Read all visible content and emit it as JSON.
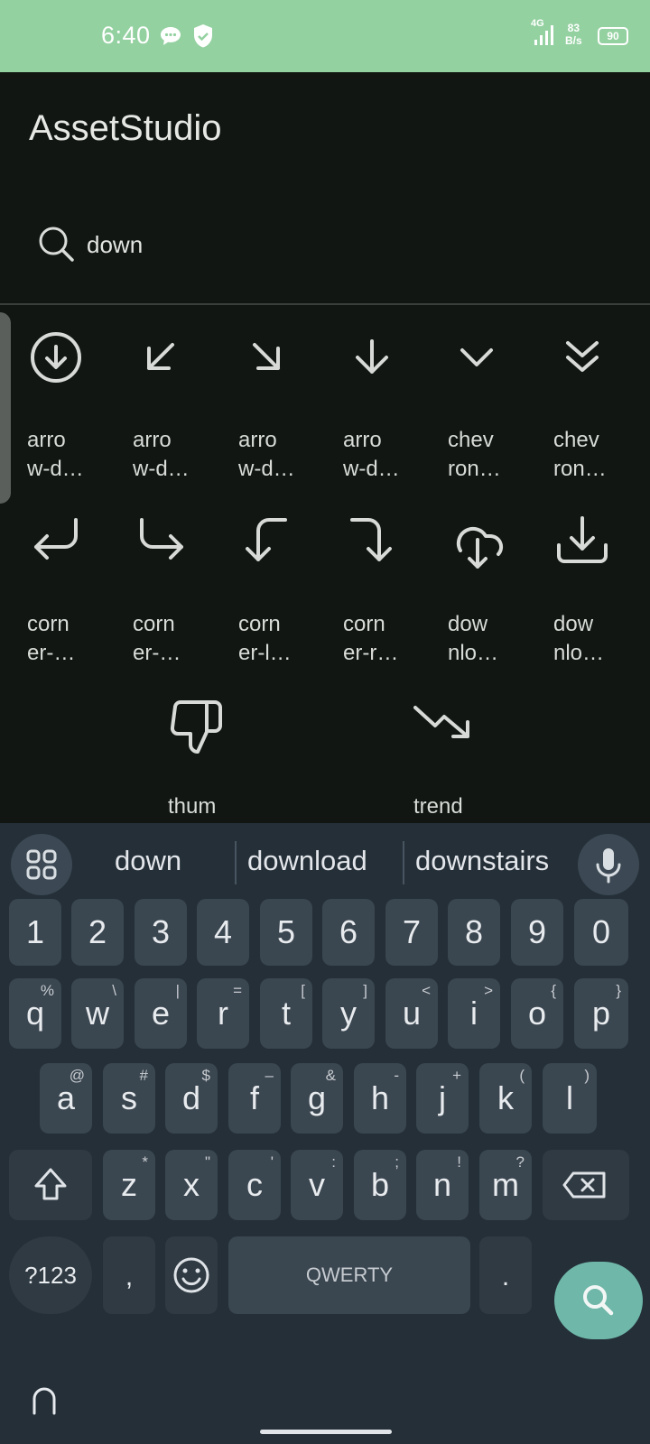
{
  "status_bar": {
    "time": "6:40",
    "network": "4G",
    "speed_value": "83",
    "speed_unit": "B/s",
    "battery": "90"
  },
  "app": {
    "title": "AssetStudio",
    "search": {
      "value": "down",
      "icon": "search-icon"
    }
  },
  "icons": [
    {
      "label": "arro\nw-d…",
      "icon": "arrow-down-circle"
    },
    {
      "label": "arro\nw-d…",
      "icon": "arrow-down-left"
    },
    {
      "label": "arro\nw-d…",
      "icon": "arrow-down-right"
    },
    {
      "label": "arro\nw-d…",
      "icon": "arrow-down"
    },
    {
      "label": "chev\nron…",
      "icon": "chevron-down"
    },
    {
      "label": "chev\nron…",
      "icon": "chevrons-down"
    },
    {
      "label": "corn\ner-…",
      "icon": "corner-down-left"
    },
    {
      "label": "corn\ner-…",
      "icon": "corner-down-right"
    },
    {
      "label": "corn\ner-l…",
      "icon": "corner-left-down"
    },
    {
      "label": "corn\ner-r…",
      "icon": "corner-right-down"
    },
    {
      "label": "dow\nnlo…",
      "icon": "download-cloud"
    },
    {
      "label": "dow\nnlo…",
      "icon": "download"
    },
    {
      "label": "thum\nbs-",
      "icon": "thumbs-down"
    },
    {
      "label": "trend\ning",
      "icon": "trending-down"
    }
  ],
  "keyboard": {
    "suggestions": [
      "down",
      "download",
      "downstairs"
    ],
    "number_row": [
      "1",
      "2",
      "3",
      "4",
      "5",
      "6",
      "7",
      "8",
      "9",
      "0"
    ],
    "row1": [
      {
        "key": "q",
        "sup": "%"
      },
      {
        "key": "w",
        "sup": "\\"
      },
      {
        "key": "e",
        "sup": "|"
      },
      {
        "key": "r",
        "sup": "="
      },
      {
        "key": "t",
        "sup": "["
      },
      {
        "key": "y",
        "sup": "]"
      },
      {
        "key": "u",
        "sup": "<"
      },
      {
        "key": "i",
        "sup": ">"
      },
      {
        "key": "o",
        "sup": "{"
      },
      {
        "key": "p",
        "sup": "}"
      }
    ],
    "row2": [
      {
        "key": "a",
        "sup": "@"
      },
      {
        "key": "s",
        "sup": "#"
      },
      {
        "key": "d",
        "sup": "$"
      },
      {
        "key": "f",
        "sup": "–"
      },
      {
        "key": "g",
        "sup": "&"
      },
      {
        "key": "h",
        "sup": "-"
      },
      {
        "key": "j",
        "sup": "+"
      },
      {
        "key": "k",
        "sup": "("
      },
      {
        "key": "l",
        "sup": ")"
      }
    ],
    "row3": [
      {
        "key": "z",
        "sup": "*"
      },
      {
        "key": "x",
        "sup": "\""
      },
      {
        "key": "c",
        "sup": "'"
      },
      {
        "key": "v",
        "sup": ":"
      },
      {
        "key": "b",
        "sup": ";"
      },
      {
        "key": "n",
        "sup": "!"
      },
      {
        "key": "m",
        "sup": "?"
      }
    ],
    "symbols_key": "?123",
    "comma_key": ",",
    "space_label": "QWERTY",
    "period_key": "."
  }
}
